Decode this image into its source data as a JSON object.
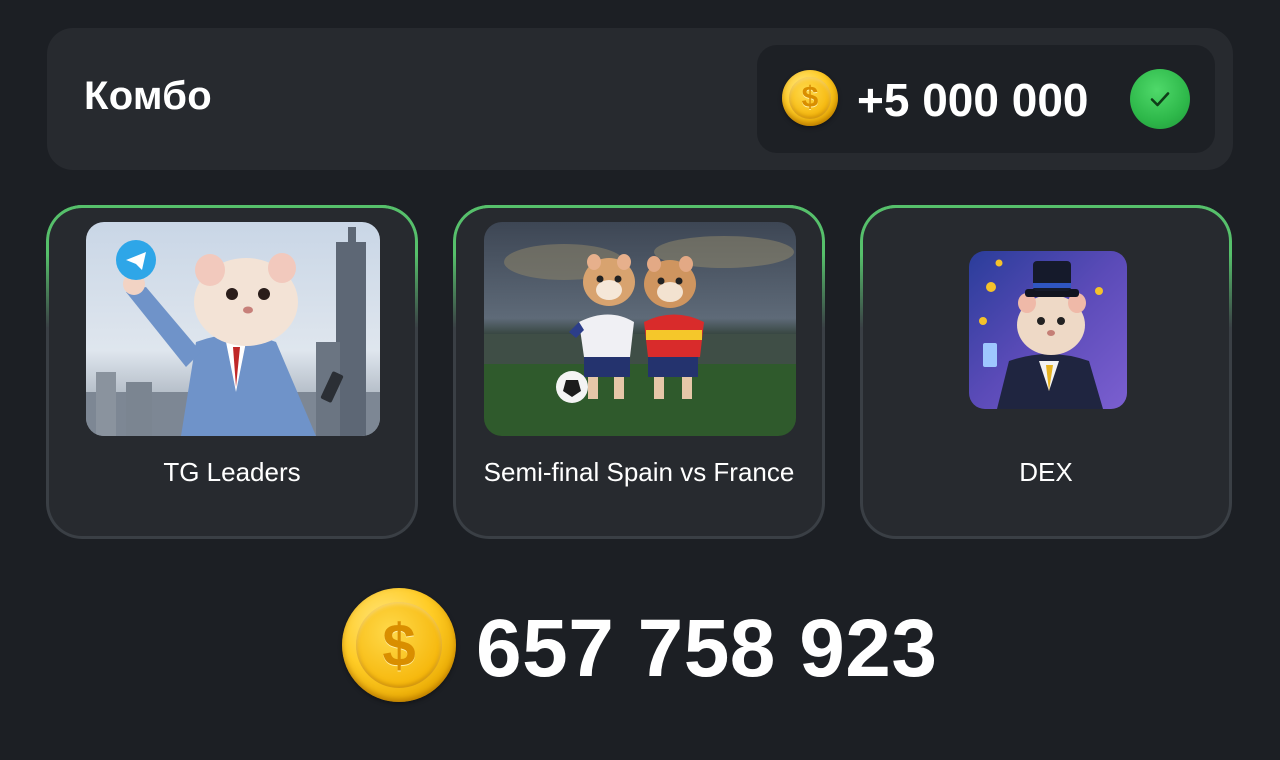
{
  "combo": {
    "title": "Комбо",
    "reward": "+5 000 000",
    "reward_icon": "coin-icon",
    "status_icon": "check-circle-icon",
    "status_color": "#2eb84a"
  },
  "cards": [
    {
      "label": "TG Leaders",
      "image": "hamster-businessman-telegram-image",
      "completed": true
    },
    {
      "label": "Semi-final Spain vs France",
      "image": "hamsters-football-match-image",
      "completed": true
    },
    {
      "label": "DEX",
      "image": "hamster-top-hat-coins-image",
      "completed": true
    }
  ],
  "balance": {
    "value": "657 758 923",
    "icon": "coin-icon"
  },
  "colors": {
    "background": "#1c1f24",
    "panel": "#272a2f",
    "accent_green": "#56c06b",
    "coin_gold": "#f6b80d"
  }
}
